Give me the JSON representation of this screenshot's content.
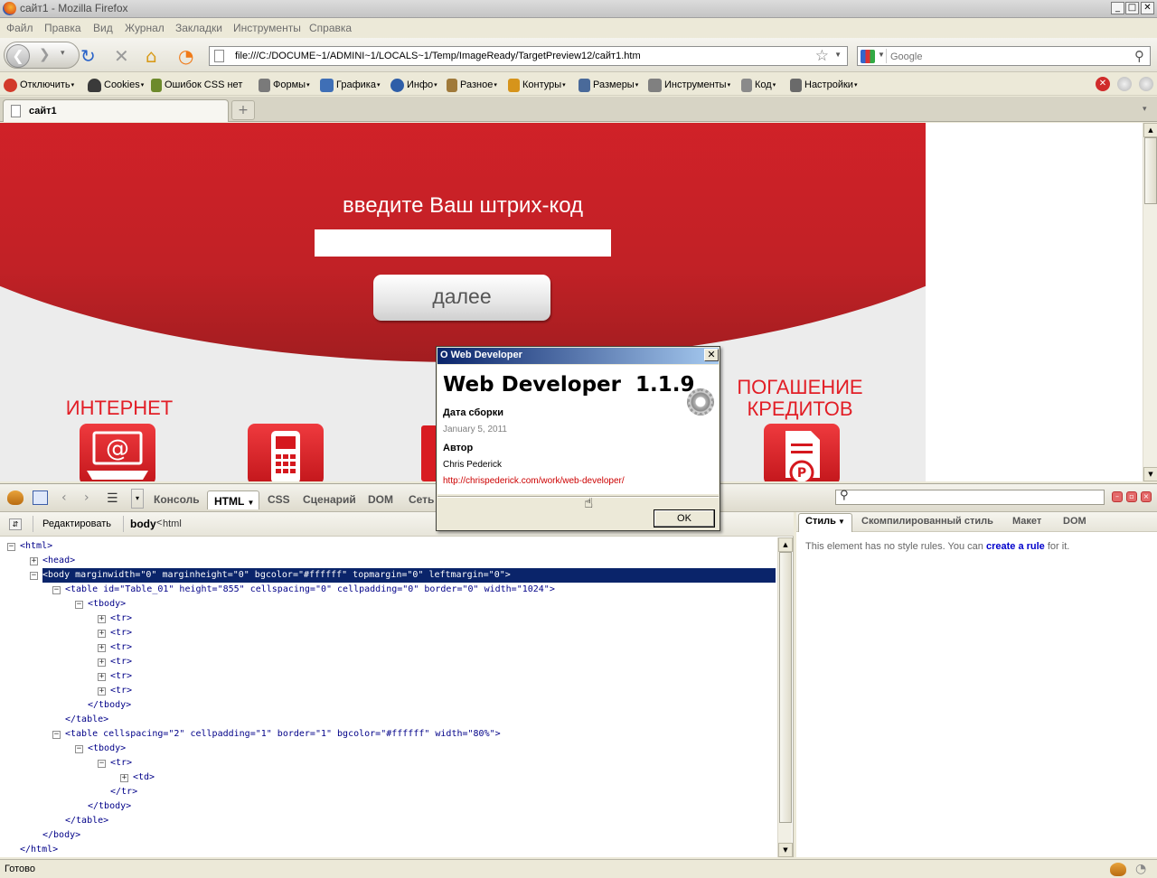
{
  "window": {
    "title": "сайт1 - Mozilla Firefox",
    "btn_min": "_",
    "btn_max": "□",
    "btn_close": "✕"
  },
  "menu": [
    "Файл",
    "Правка",
    "Вид",
    "Журнал",
    "Закладки",
    "Инструменты",
    "Справка"
  ],
  "nav": {
    "url": "file:///C:/DOCUME~1/ADMINI~1/LOCALS~1/Temp/ImageReady/TargetPreview12/сайт1.htm",
    "search_placeholder": "Google",
    "icons": [
      "back-icon",
      "forward-icon",
      "reload-icon",
      "stop-icon",
      "home-icon",
      "rss-icon"
    ]
  },
  "webdev": {
    "items": [
      "Отключить",
      "Cookies",
      "Ошибок CSS нет",
      "Формы",
      "Графика",
      "Инфо",
      "Разное",
      "Контуры",
      "Размеры",
      "Инструменты",
      "Код",
      "Настройки"
    ],
    "colors": [
      "#d23a2a",
      "#3a3a3a",
      "#6d8a2c",
      "#7a7a7a",
      "#3f6fb6",
      "#2e5ea8",
      "#a07a3a",
      "#d6941b",
      "#4a6a9a",
      "#808080",
      "#8a8a8a",
      "#6a6a6a"
    ]
  },
  "tabs": [
    {
      "label": "сайт1"
    }
  ],
  "site": {
    "prompt": "введите Ваш штрих-код",
    "next_button": "далее",
    "cat_internet": "ИНТЕРНЕТ",
    "cat_credit_1": "ПОГАШЕНИЕ",
    "cat_credit_2": "КРЕДИТОВ",
    "colors": {
      "red": "#e8222b",
      "gray": "#ececec"
    }
  },
  "firebug": {
    "tabs": [
      "Консоль",
      "HTML",
      "CSS",
      "Сценарий",
      "DOM",
      "Сеть"
    ],
    "edit_button": "Редактировать",
    "breadcrumb_current": "body",
    "breadcrumb_sep": "<",
    "breadcrumb_parent": "html",
    "style_tabs": [
      "Стиль",
      "Скомпилированный стиль",
      "Макет",
      "DOM"
    ],
    "no_rules_prefix": "This element has no style rules. You can",
    "no_rules_link": "create a rule",
    "no_rules_suffix": "for it."
  },
  "tree": [
    {
      "indent": 0,
      "toggle": "minus",
      "text": "<html>"
    },
    {
      "indent": 1,
      "toggle": "plus",
      "text": "<head>"
    },
    {
      "indent": 1,
      "toggle": "minus",
      "text": "<body marginwidth=\"0\" marginheight=\"0\" bgcolor=\"#ffffff\" topmargin=\"0\" leftmargin=\"0\">",
      "selected": true
    },
    {
      "indent": 2,
      "toggle": "minus",
      "text": "<table id=\"Table_01\" height=\"855\" cellspacing=\"0\" cellpadding=\"0\" border=\"0\" width=\"1024\">"
    },
    {
      "indent": 3,
      "toggle": "minus",
      "text": "<tbody>"
    },
    {
      "indent": 4,
      "toggle": "plus",
      "text": "<tr>"
    },
    {
      "indent": 4,
      "toggle": "plus",
      "text": "<tr>"
    },
    {
      "indent": 4,
      "toggle": "plus",
      "text": "<tr>"
    },
    {
      "indent": 4,
      "toggle": "plus",
      "text": "<tr>"
    },
    {
      "indent": 4,
      "toggle": "plus",
      "text": "<tr>"
    },
    {
      "indent": 4,
      "toggle": "plus",
      "text": "<tr>"
    },
    {
      "indent": 3,
      "toggle": "",
      "text": "</tbody>"
    },
    {
      "indent": 2,
      "toggle": "",
      "text": "</table>"
    },
    {
      "indent": 2,
      "toggle": "minus",
      "text": "<table cellspacing=\"2\" cellpadding=\"1\" border=\"1\" bgcolor=\"#ffffff\" width=\"80%\">"
    },
    {
      "indent": 3,
      "toggle": "minus",
      "text": "<tbody>"
    },
    {
      "indent": 4,
      "toggle": "minus",
      "text": "<tr>"
    },
    {
      "indent": 5,
      "toggle": "plus",
      "text": "<td>"
    },
    {
      "indent": 4,
      "toggle": "",
      "text": "</tr>"
    },
    {
      "indent": 3,
      "toggle": "",
      "text": "</tbody>"
    },
    {
      "indent": 2,
      "toggle": "",
      "text": "</table>"
    },
    {
      "indent": 1,
      "toggle": "",
      "text": "</body>"
    },
    {
      "indent": 0,
      "toggle": "",
      "text": "</html>"
    }
  ],
  "dialog": {
    "title": "О Web Developer",
    "name": "Web Developer  1.1.9",
    "build_label": "Дата сборки",
    "build_date": "January 5, 2011",
    "author_label": "Автор",
    "author": "Chris Pederick",
    "link": "http://chrispederick.com/work/web-developer/",
    "ok": "OK"
  },
  "status": "Готово"
}
